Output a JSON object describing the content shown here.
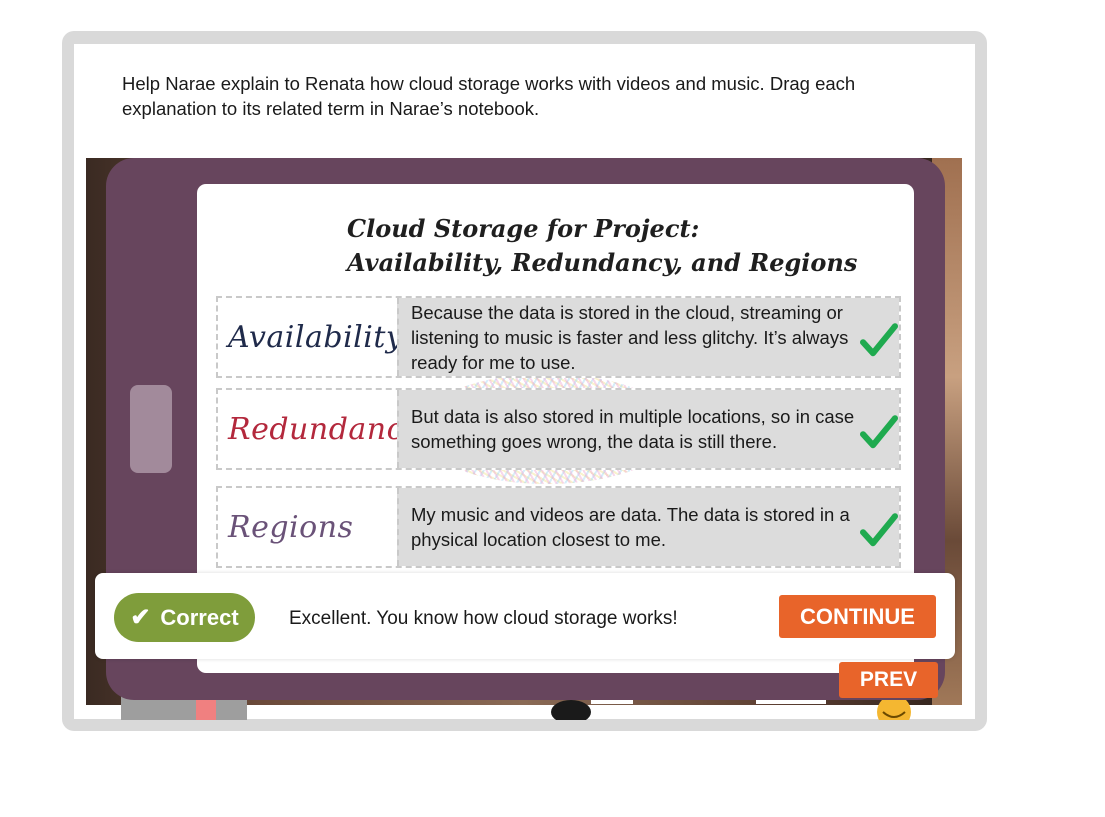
{
  "instructions": "Help Narae explain to Renata how cloud storage works with videos and music. Drag each explanation to its related term in Narae’s notebook.",
  "notebook": {
    "title_line1": "Cloud Storage for Project:",
    "title_line2": "Availability, Redundancy, and Regions",
    "rows": [
      {
        "term": "Availability",
        "term_color": "#1f2a4a",
        "answer": "Because the data is stored in the cloud, streaming or listening to music is faster and less glitchy. It’s always ready for me to use.",
        "icon": "checkmark-icon"
      },
      {
        "term": "Redundancy",
        "term_color": "#b3283c",
        "answer": "But data is also stored in multiple locations, so in case something goes wrong, the data is still there.",
        "icon": "checkmark-icon"
      },
      {
        "term": "Regions",
        "term_color": "#6a5278",
        "answer": "My music and videos are data. The data is stored in a physical location closest to me.",
        "icon": "checkmark-icon"
      }
    ]
  },
  "feedback": {
    "badge_label": "Correct",
    "badge_icon": "checkmark-icon",
    "message": "Excellent. You know how cloud storage works!",
    "continue_label": "CONTINUE"
  },
  "nav": {
    "prev_label": "PREV"
  },
  "colors": {
    "tablet": "#67455d",
    "accent_orange": "#e8642a",
    "correct_green": "#7f9d3b",
    "check_green": "#1faa4f"
  }
}
